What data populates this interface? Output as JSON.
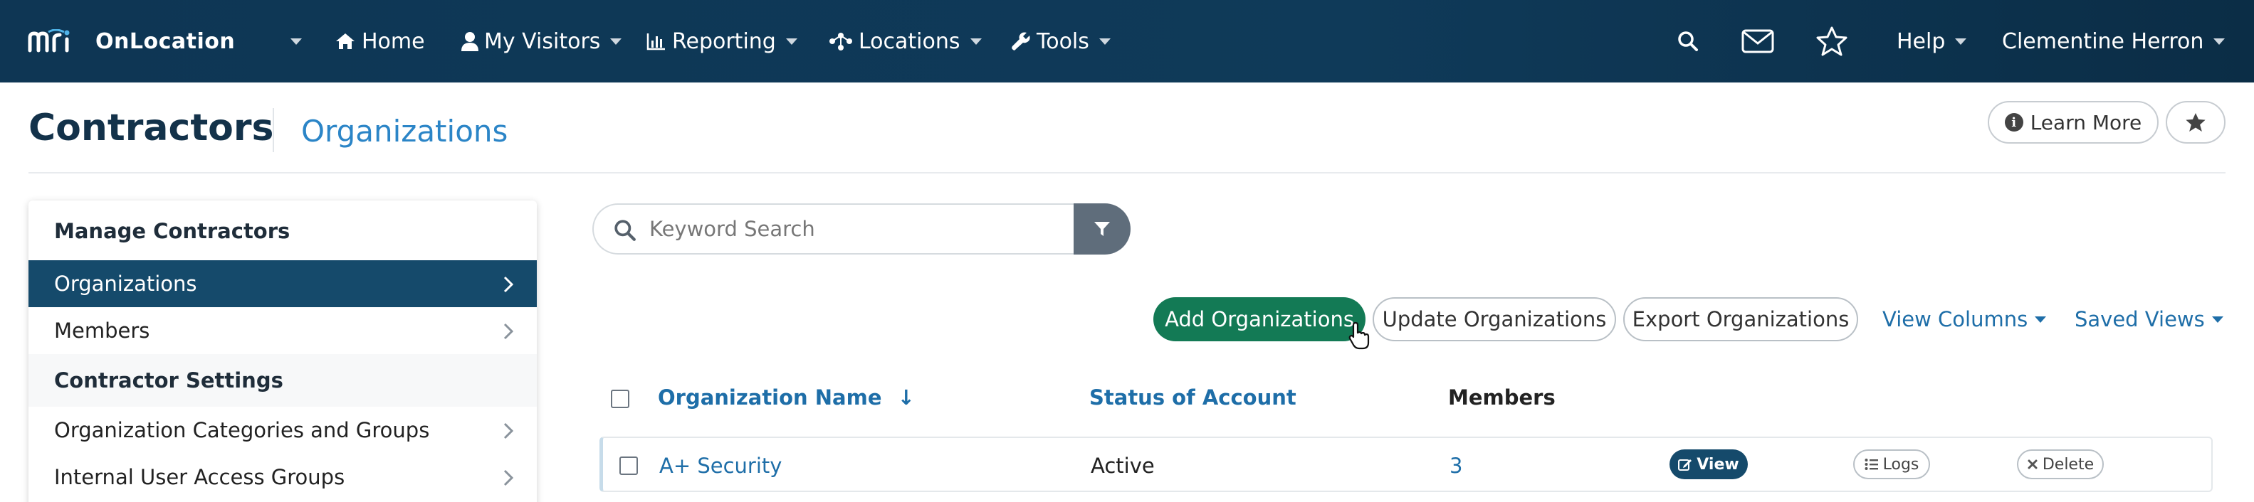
{
  "colors": {
    "nav_bg": "#0e3654",
    "primary_dark": "#154a6b",
    "accent_link": "#1e6ea8",
    "success": "#137a55",
    "filter_button": "#5f6d7b"
  },
  "topnav": {
    "brand_logo_icon": "mri-logo",
    "brand": "OnLocation",
    "items": [
      {
        "label": "Home",
        "icon": "home-icon"
      },
      {
        "label": "My Visitors",
        "icon": "user-icon"
      },
      {
        "label": "Reporting",
        "icon": "bar-chart-icon"
      },
      {
        "label": "Locations",
        "icon": "nodes-icon"
      },
      {
        "label": "Tools",
        "icon": "wrench-icon"
      }
    ],
    "right": {
      "search_icon": "search-icon",
      "mail_icon": "envelope-icon",
      "star_icon": "star-icon",
      "help": "Help",
      "user": "Clementine Herron"
    }
  },
  "header": {
    "title": "Contractors",
    "subtitle": "Organizations",
    "learn_more": "Learn More"
  },
  "sidebar": {
    "sections": [
      {
        "heading": "Manage Contractors",
        "items": [
          {
            "label": "Organizations",
            "active": true
          },
          {
            "label": "Members",
            "active": false
          }
        ]
      },
      {
        "heading": "Contractor Settings",
        "items": [
          {
            "label": "Organization Categories and Groups",
            "active": false
          },
          {
            "label": "Internal User Access Groups",
            "active": false
          }
        ]
      }
    ]
  },
  "search": {
    "placeholder": "Keyword Search"
  },
  "actions": {
    "add": "Add Organizations",
    "update": "Update Organizations",
    "export": "Export Organizations",
    "view_columns": "View Columns",
    "saved_views": "Saved Views"
  },
  "table": {
    "columns": [
      "Organization Name",
      "Status of Account",
      "Members"
    ],
    "sort_indicator": "↓",
    "rows": [
      {
        "name": "A+ Security",
        "status": "Active",
        "members": "3"
      }
    ],
    "row_actions": {
      "view": "View",
      "logs": "Logs",
      "delete": "Delete"
    }
  }
}
